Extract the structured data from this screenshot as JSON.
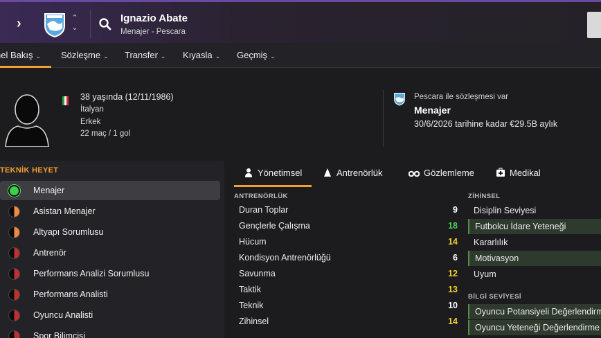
{
  "header": {
    "name": "Ignazio Abate",
    "subtitle": "Menajer - Pescara"
  },
  "tabs": [
    {
      "label": "nel Bakış"
    },
    {
      "label": "Sözleşme"
    },
    {
      "label": "Transfer"
    },
    {
      "label": "Kıyasla"
    },
    {
      "label": "Geçmiş"
    }
  ],
  "profile": {
    "age": "38 yaşında (12/11/1986)",
    "nationality": "İtalyan",
    "gender": "Erkek",
    "games": "22 maç / 1 gol"
  },
  "contract": {
    "label": "Pescara ile sözleşmesi var",
    "role": "Menajer",
    "until": "30/6/2026 tarihine kadar €29.5B aylık"
  },
  "staff": {
    "title": "TEKNİK HEYET",
    "items": [
      {
        "label": "Menajer",
        "status": "green"
      },
      {
        "label": "Asistan Menajer",
        "status": "orange"
      },
      {
        "label": "Altyapı Sorumlusu",
        "status": "orange"
      },
      {
        "label": "Antrenör",
        "status": "red"
      },
      {
        "label": "Performans Analizi Sorumlusu",
        "status": "red"
      },
      {
        "label": "Performans Analisti",
        "status": "red"
      },
      {
        "label": "Oyuncu Analisti",
        "status": "red"
      },
      {
        "label": "Spor Bilimcisi",
        "status": "red"
      }
    ]
  },
  "attr_tabs": [
    {
      "label": "Yönetimsel",
      "icon": "manager-icon"
    },
    {
      "label": "Antrenörlük",
      "icon": "cone-icon"
    },
    {
      "label": "Gözlemleme",
      "icon": "binoculars-icon"
    },
    {
      "label": "Medikal",
      "icon": "medical-kit-icon"
    }
  ],
  "coaching": {
    "title": "ANTRENÖRLÜK",
    "attributes": [
      {
        "name": "Duran Toplar",
        "value": "9",
        "color": "#ffffff"
      },
      {
        "name": "Gençlerle Çalışma",
        "value": "18",
        "color": "#4ad05a"
      },
      {
        "name": "Hücum",
        "value": "14",
        "color": "#f0d030"
      },
      {
        "name": "Kondisyon Antrenörlüğü",
        "value": "6",
        "color": "#ffffff"
      },
      {
        "name": "Savunma",
        "value": "12",
        "color": "#f0d030"
      },
      {
        "name": "Taktik",
        "value": "13",
        "color": "#f0d030"
      },
      {
        "name": "Teknik",
        "value": "10",
        "color": "#ffffff"
      },
      {
        "name": "Zihinsel",
        "value": "14",
        "color": "#f0d030"
      }
    ]
  },
  "mental": {
    "title": "ZİHİNSEL",
    "attributes": [
      {
        "name": "Disiplin Seviyesi",
        "highlighted": false
      },
      {
        "name": "Futbolcu İdare Yeteneği",
        "highlighted": true
      },
      {
        "name": "Kararlılık",
        "highlighted": false
      },
      {
        "name": "Motivasyon",
        "highlighted": true
      },
      {
        "name": "Uyum",
        "highlighted": false
      }
    ]
  },
  "knowledge": {
    "title": "BİLGİ SEVİYESİ",
    "attributes": [
      {
        "name": "Oyuncu Potansiyeli Değerlendirm",
        "highlighted": true
      },
      {
        "name": "Oyuncu Yeteneği Değerlendirme",
        "highlighted": true
      }
    ]
  },
  "colors": {
    "accent": "#f0a030",
    "green": "#3ad04a",
    "orange": "#f08a40",
    "red": "#c03030"
  }
}
